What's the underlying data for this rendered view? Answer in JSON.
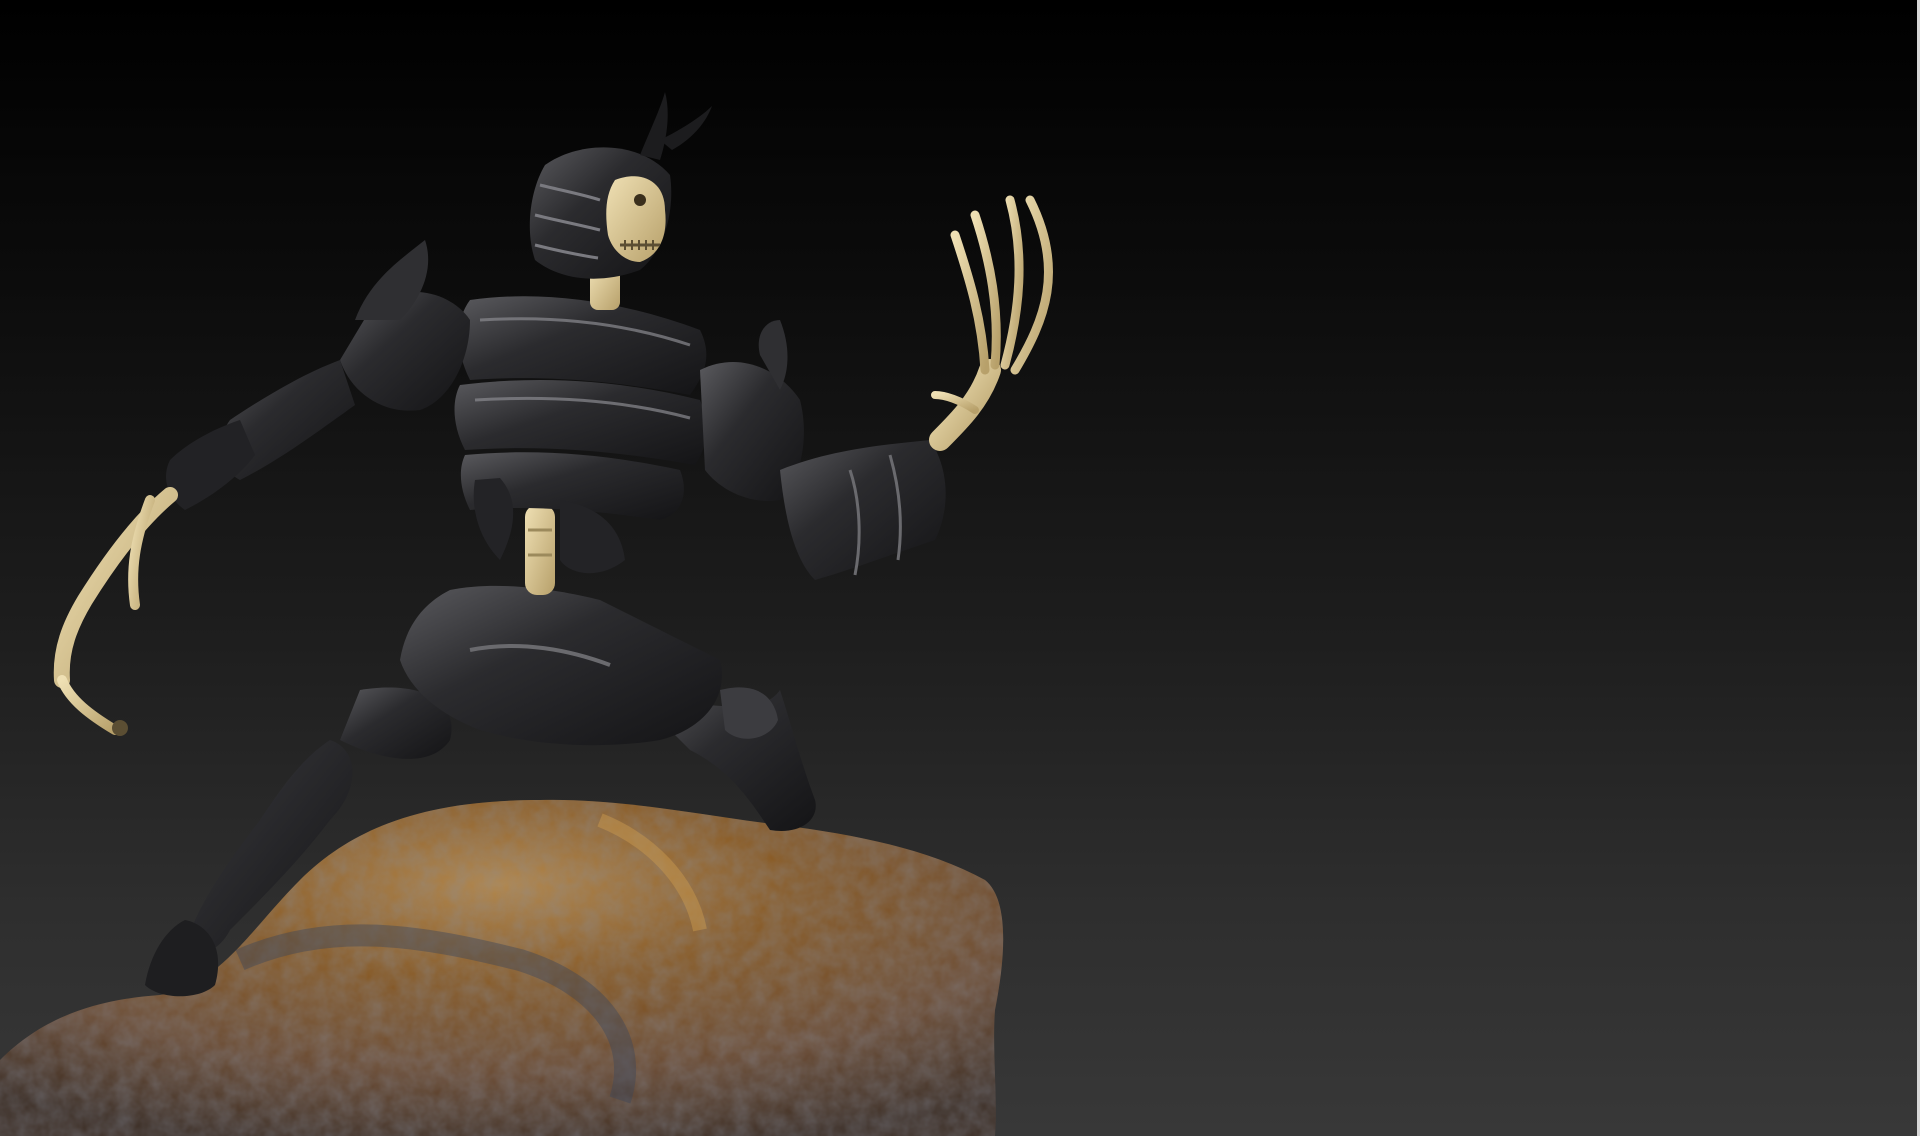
{
  "canvas": {
    "background_top": "#000000",
    "background_bottom": "#383838",
    "edge_color": "#d8d8d8"
  },
  "scene": {
    "subject": "skeleton-warrior-figure",
    "armor_color": "#2b2b2d",
    "armor_highlight": "#6a6a6e",
    "bone_color": "#d9c79a",
    "bone_shadow": "#9c8a5c",
    "rock_color": "#8a5a22",
    "rock_highlight": "#b98a44",
    "rock_shadow": "#4a3a2e"
  }
}
